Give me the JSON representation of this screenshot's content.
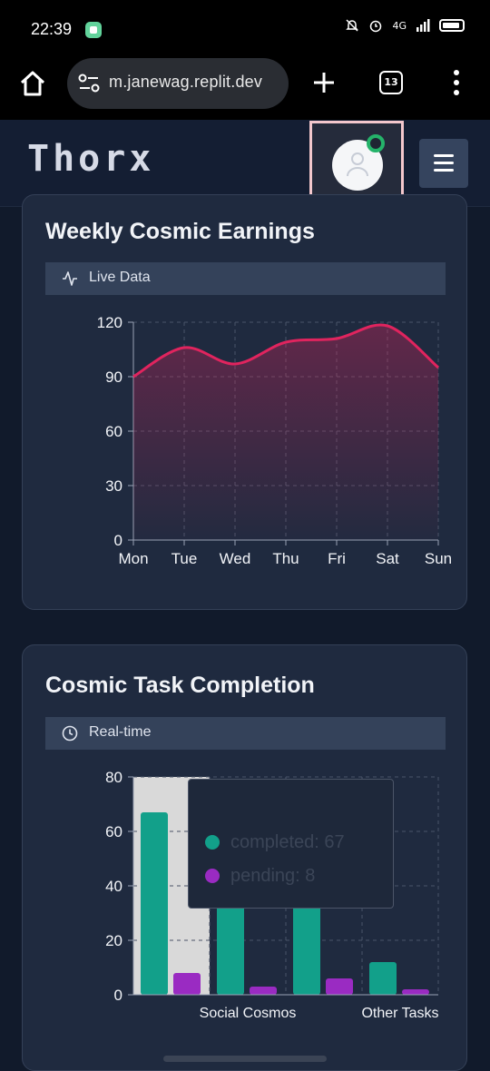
{
  "status_bar": {
    "time": "22:39",
    "network": "4G"
  },
  "browser": {
    "url": "m.janewag.replit.dev",
    "tab_count": "13"
  },
  "app": {
    "logo": "Thorx"
  },
  "colors": {
    "earnings_line": "#e0245e",
    "completed": "#12a08a",
    "pending": "#9a2bc2",
    "online": "#25b36a"
  },
  "earnings_card": {
    "title": "Weekly Cosmic Earnings",
    "badge": "Live Data",
    "badge_icon": "activity-icon"
  },
  "tasks_card": {
    "title": "Cosmic Task Completion",
    "badge": "Real-time",
    "badge_icon": "clock-icon"
  },
  "tooltip": {
    "completed": "completed: 67",
    "pending": "pending: 8"
  },
  "chart_data": [
    {
      "type": "area",
      "categories": [
        "Mon",
        "Tue",
        "Wed",
        "Thu",
        "Fri",
        "Sat",
        "Sun"
      ],
      "values": [
        90,
        106,
        97,
        109,
        111,
        118,
        95
      ],
      "ylim": [
        0,
        120
      ],
      "yticks": [
        0,
        30,
        60,
        90,
        120
      ],
      "grid": true
    },
    {
      "type": "bar",
      "categories": [
        "",
        "Social Cosmos",
        "",
        "Other Tasks"
      ],
      "series": [
        {
          "values": [
            67,
            33,
            33,
            12
          ]
        },
        {
          "values": [
            8,
            3,
            6,
            2
          ]
        }
      ],
      "ylim": [
        0,
        80
      ],
      "yticks": [
        0,
        20,
        40,
        60,
        80
      ],
      "grid": true
    }
  ]
}
